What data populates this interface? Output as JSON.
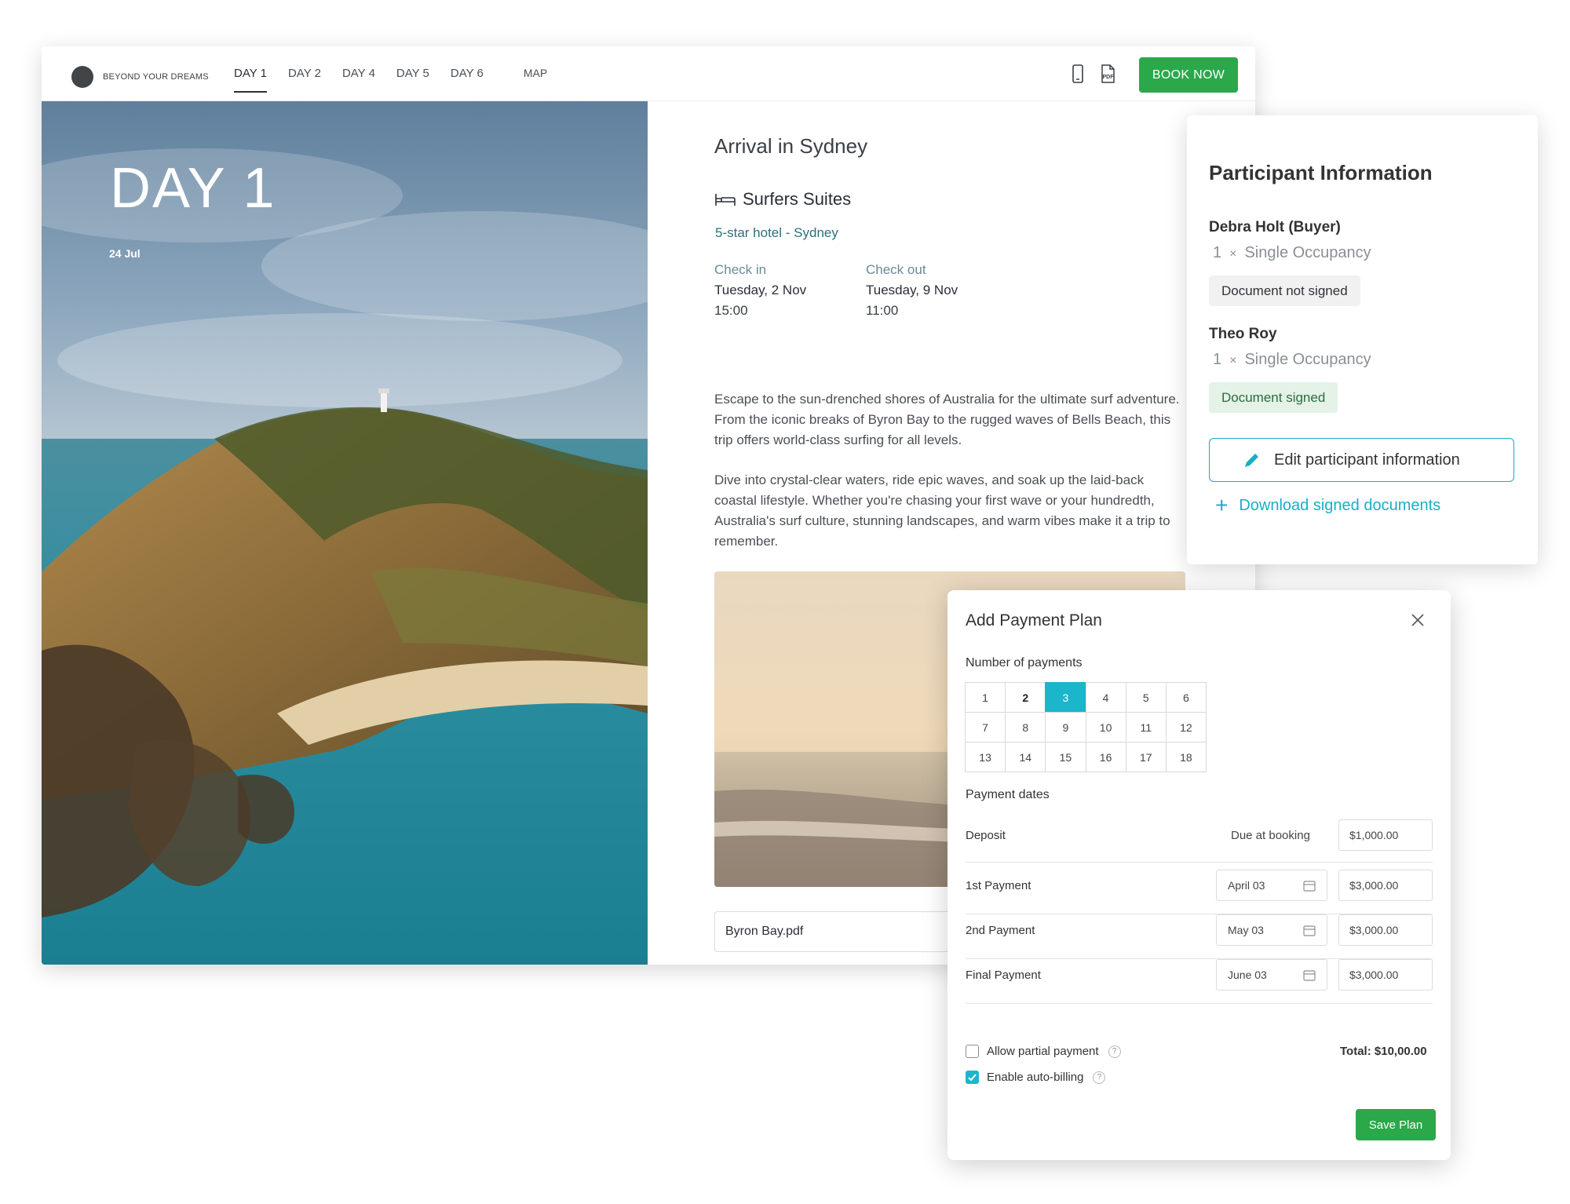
{
  "brand": {
    "name": "BEYOND YOUR DREAMS"
  },
  "nav": {
    "tabs": [
      "DAY 1",
      "DAY 2",
      "DAY 4",
      "DAY 5",
      "DAY 6"
    ],
    "active_tab": "DAY 1",
    "map_label": "MAP",
    "book_now_label": "BOOK NOW",
    "pdf_icon_text": "PDF"
  },
  "hero": {
    "day_label": "DAY 1",
    "date": "24 Jul"
  },
  "day": {
    "title": "Arrival in Sydney",
    "hotel_name": "Surfers Suites",
    "hotel_subtitle": "5-star hotel - Sydney",
    "check_in": {
      "label": "Check in",
      "date": "Tuesday, 2 Nov",
      "time": "15:00"
    },
    "check_out": {
      "label": "Check out",
      "date": "Tuesday, 9 Nov",
      "time": "11:00"
    },
    "description_1": "Escape to the sun-drenched shores of Australia for the ultimate surf adventure. From the iconic breaks of Byron Bay to the rugged waves of Bells Beach, this trip offers world-class surfing for all levels.",
    "description_2": "Dive into crystal-clear waters, ride epic waves, and soak up the laid-back coastal lifestyle. Whether you're chasing your first wave or your hundredth, Australia's surf culture, stunning landscapes, and warm vibes make it a trip to remember.",
    "attachment": "Byron Bay.pdf"
  },
  "participants": {
    "title": "Participant Information",
    "list": [
      {
        "name": "Debra Holt (Buyer)",
        "qty": "1",
        "times": "×",
        "room": "Single Occupancy",
        "status": "Document not signed"
      },
      {
        "name": "Theo Roy",
        "qty": "1",
        "times": "×",
        "room": "Single Occupancy",
        "status": "Document signed"
      }
    ],
    "edit_label": "Edit participant information",
    "download_label": "Download signed documents",
    "plus": "+"
  },
  "payment_plan": {
    "title": "Add Payment Plan",
    "number_label": "Number of payments",
    "numbers": [
      "1",
      "2",
      "3",
      "4",
      "5",
      "6",
      "7",
      "8",
      "9",
      "10",
      "11",
      "12",
      "13",
      "14",
      "15",
      "16",
      "17",
      "18"
    ],
    "selected": "3",
    "dates_label": "Payment dates",
    "rows": [
      {
        "label": "Deposit",
        "due": "Due at booking",
        "date": "",
        "amount": "$1,000.00"
      },
      {
        "label": "1st Payment",
        "due": "",
        "date": "April 03",
        "amount": "$3,000.00"
      },
      {
        "label": "2nd Payment",
        "due": "",
        "date": "May 03",
        "amount": "$3,000.00"
      },
      {
        "label": "Final Payment",
        "due": "",
        "date": "June 03",
        "amount": "$3,000.00"
      }
    ],
    "partial_label": "Allow partial payment",
    "partial_checked": false,
    "autobilling_label": "Enable auto-billing",
    "autobilling_checked": true,
    "help": "?",
    "total": "Total: $10,00.00",
    "save_label": "Save Plan"
  },
  "colors": {
    "accent": "#1bb5cc",
    "green": "#2aa84a"
  }
}
